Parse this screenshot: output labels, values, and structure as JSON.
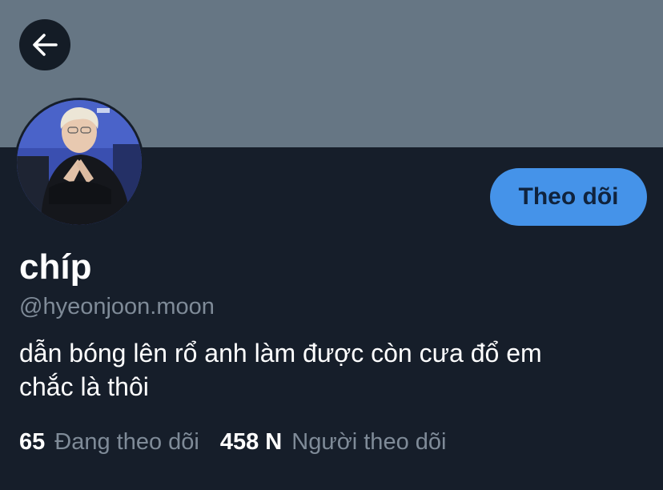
{
  "header": {
    "back_icon": "arrow-left-icon"
  },
  "colors": {
    "banner": "#667684",
    "background": "#161e2a",
    "accent": "#4593e9",
    "secondary_text": "#7f8b98"
  },
  "profile": {
    "avatar": "profile-photo",
    "follow_label": "Theo dõi",
    "display_name": "chíp",
    "handle": "@hyeonjoon.moon",
    "bio_lines": [
      "dẫn bóng lên rổ anh làm được còn cưa đổ em",
      "chắc là thôi"
    ]
  },
  "stats": {
    "following_count": "65",
    "following_label": "Đang theo dõi",
    "followers_count": "458 N",
    "followers_label": "Người theo dõi"
  }
}
